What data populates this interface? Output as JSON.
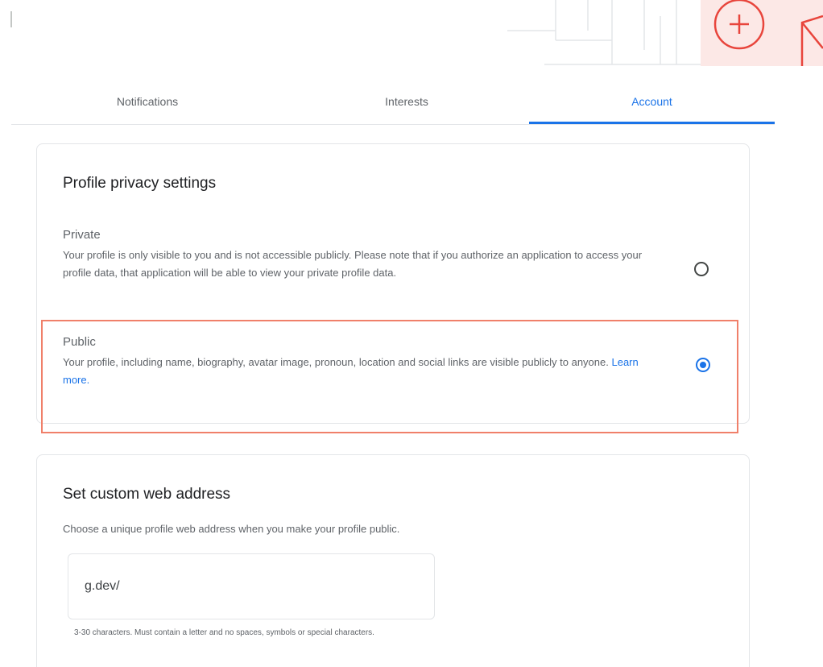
{
  "tabs": [
    {
      "label": "Notifications",
      "active": false
    },
    {
      "label": "Interests",
      "active": false
    },
    {
      "label": "Account",
      "active": true
    }
  ],
  "privacy": {
    "title": "Profile privacy settings",
    "options": [
      {
        "label": "Private",
        "description": "Your profile is only visible to you and is not accessible publicly. Please note that if you authorize an application to access your profile data, that application will be able to view your private profile data.",
        "selected": false
      },
      {
        "label": "Public",
        "description": "Your profile, including name, biography, avatar image, pronoun, location and social links are visible publicly to anyone.",
        "link": "Learn more.",
        "selected": true
      }
    ]
  },
  "web_address": {
    "title": "Set custom web address",
    "subtitle": "Choose a unique profile web address when you make your profile public.",
    "value": "g.dev/",
    "hint": "3-30 characters. Must contain a letter and no spaces, symbols or special characters."
  },
  "colors": {
    "accent": "#1a73e8",
    "highlight": "#f0806a",
    "decor_red": "#e8453c"
  },
  "icons": [
    "plus-circle-icon"
  ]
}
